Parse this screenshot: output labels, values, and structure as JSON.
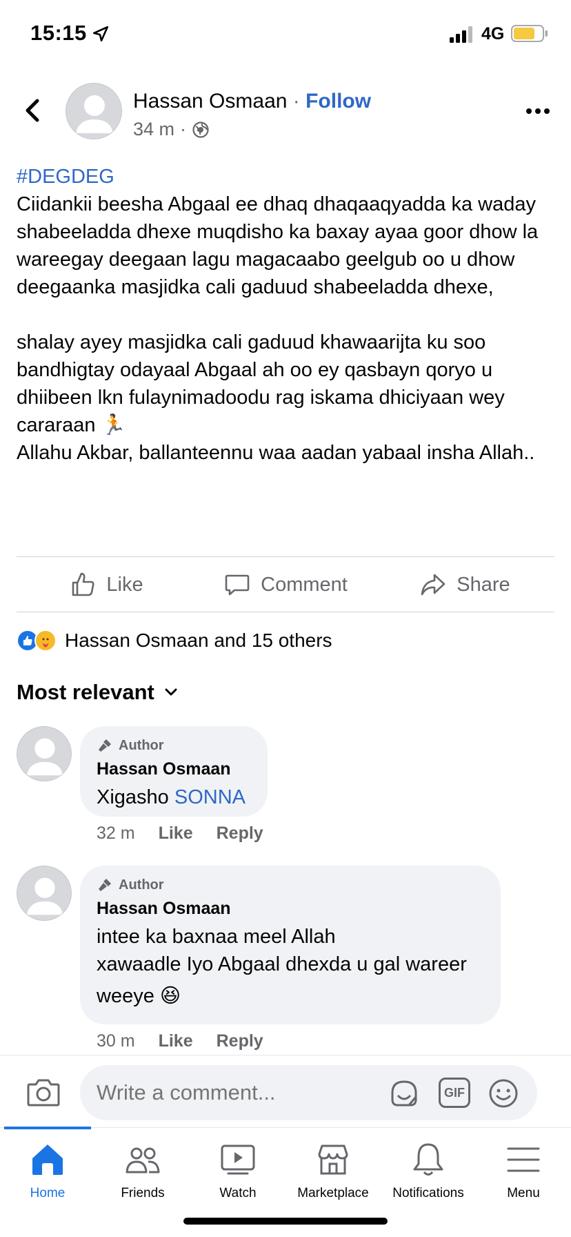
{
  "status_bar": {
    "time": "15:15",
    "network": "4G"
  },
  "post": {
    "author_name": "Hassan Osmaan",
    "separator": " · ",
    "follow_label": "Follow",
    "time_ago": "34 m",
    "meta_dot": "·",
    "hashtag": "#DEGDEG",
    "paragraph_1": "Ciidankii beesha Abgaal ee dhaq dhaqaaqyadda ka waday shabeeladda dhexe muqdisho ka baxay ayaa goor dhow la wareegay deegaan lagu magacaabo geelgub oo u dhow deegaanka masjidka cali gaduud shabeeladda dhexe,",
    "paragraph_2": "shalay ayey masjidka cali gaduud khawaarijta ku soo bandhigtay odayaal Abgaal ah oo ey qasbayn qoryo u dhiibeen lkn fulaynimadoodu rag iskama dhiciyaan wey cararaan 🏃",
    "paragraph_3": "Allahu Akbar,  ballanteennu waa aadan yabaal insha Allah.."
  },
  "actions": {
    "like": "Like",
    "comment": "Comment",
    "share": "Share"
  },
  "reactions": {
    "summary": "Hassan Osmaan and 15 others"
  },
  "sort_label": "Most relevant",
  "comments": [
    {
      "badge": "Author",
      "name": "Hassan Osmaan",
      "text_prefix": "Xigasho ",
      "text_tag": "SONNA",
      "time": "32 m",
      "like": "Like",
      "reply": "Reply"
    },
    {
      "badge": "Author",
      "name": "Hassan Osmaan",
      "line_1": "intee ka baxnaa meel Allah",
      "line_2": "xawaadle Iyo Abgaal dhexda u gal wareer",
      "line_3": "weeye 😆",
      "time": "30 m",
      "like": "Like",
      "reply": "Reply"
    }
  ],
  "comment_input": {
    "placeholder": "Write a comment...",
    "gif_label": "GIF"
  },
  "tabs": [
    {
      "label": "Home",
      "icon": "home-icon",
      "active": true
    },
    {
      "label": "Friends",
      "icon": "friends-icon"
    },
    {
      "label": "Watch",
      "icon": "watch-icon"
    },
    {
      "label": "Marketplace",
      "icon": "marketplace-icon"
    },
    {
      "label": "Notifications",
      "icon": "bell-icon"
    },
    {
      "label": "Menu",
      "icon": "menu-icon"
    }
  ],
  "colors": {
    "link": "#2f68c6",
    "accent": "#1b74e4",
    "bubble": "#f0f2f5",
    "muted": "#65676b"
  }
}
